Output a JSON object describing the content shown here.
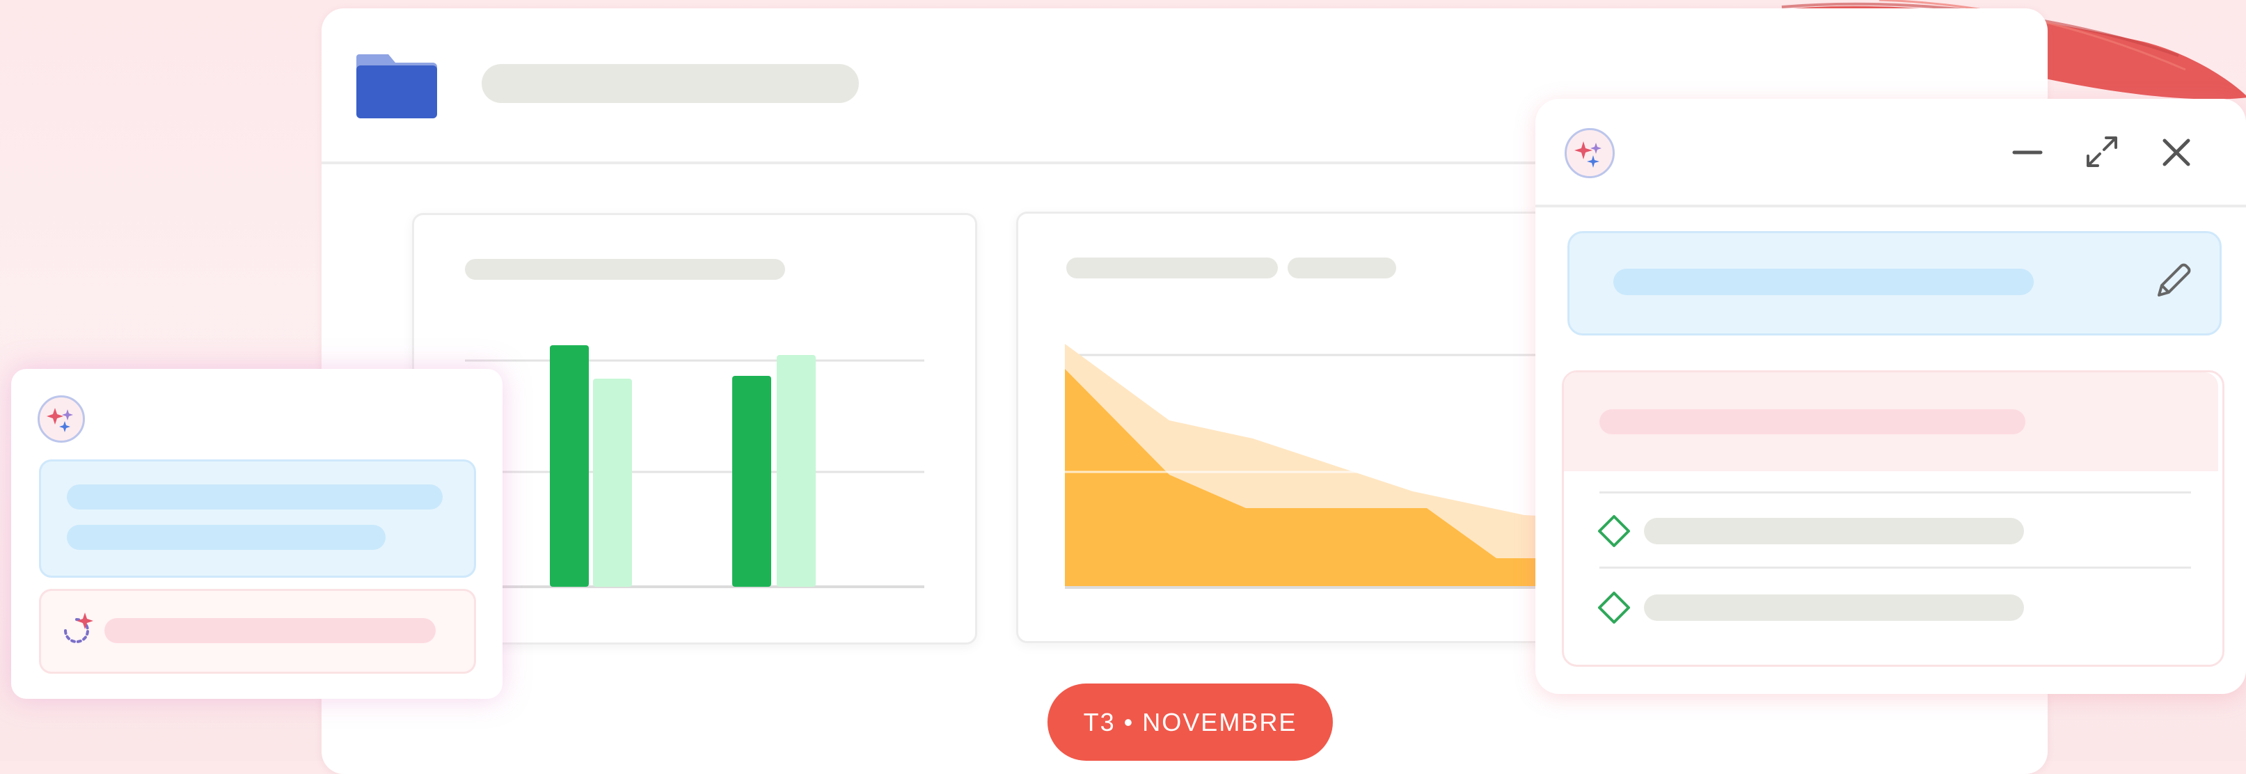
{
  "quarter_label": "T3 • NOVEMBRE",
  "icons": {
    "folder": "folder-icon",
    "sparkle_badge": "gemini-sparkle-icon",
    "minimize": "minimize-icon",
    "expand": "expand-icon",
    "close": "close-icon",
    "edit": "pencil-icon",
    "task_done": "diamond-check-icon",
    "refresh_sparkle": "sparkle-refresh-icon"
  },
  "colors": {
    "accent_pill": "#f0584a",
    "bar_dark": "#1db355",
    "bar_light": "#c6f7d6",
    "area_dark": "#ffbb47",
    "area_light": "#ffe6c2",
    "folder_blue": "#3a5fc8",
    "highlight_blue": "#e6f4fd",
    "highlight_pink": "#fdeeef",
    "placeholder_gray": "#e8e8e3"
  }
}
